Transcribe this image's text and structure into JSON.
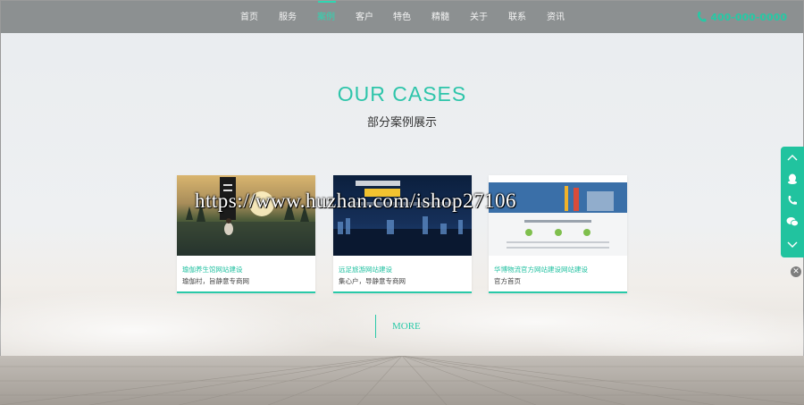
{
  "nav": {
    "items": [
      {
        "label": "首页"
      },
      {
        "label": "服务"
      },
      {
        "label": "案例"
      },
      {
        "label": "客户"
      },
      {
        "label": "特色"
      },
      {
        "label": "精髓"
      },
      {
        "label": "关于"
      },
      {
        "label": "联系"
      },
      {
        "label": "资讯"
      }
    ],
    "active": "案例",
    "phone": "400-000-0000"
  },
  "section": {
    "title": "OUR CASES",
    "subtitle": "部分案例展示"
  },
  "cards": [
    {
      "title": "瑜伽养生馆网站建设",
      "desc": "瑜伽村，旨静意专商网"
    },
    {
      "title": "远足旅游网站建设",
      "desc": "集心户，导静意专商网"
    },
    {
      "title": "华博物流官方网站建设网站建设",
      "desc": "官方首页"
    }
  ],
  "more_label": "MORE",
  "watermark": "https://www.huzhan.com/ishop27106",
  "colors": {
    "accent": "#2ec5aa",
    "nav_bg": "#8c9091",
    "sidebar": "#21c39f"
  }
}
